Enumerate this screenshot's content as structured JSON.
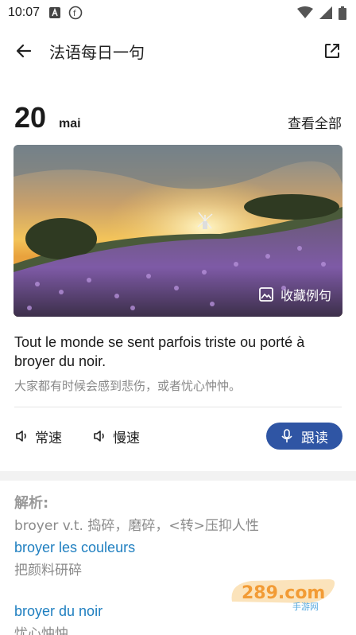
{
  "status_bar": {
    "time": "10:07",
    "left_icons": [
      "a-icon",
      "f-icon"
    ],
    "right_icons": [
      "wifi-icon",
      "signal-icon",
      "battery-icon"
    ]
  },
  "app_bar": {
    "title": "法语每日一句"
  },
  "date": {
    "day": "20",
    "month": "mai",
    "view_all": "查看全部"
  },
  "hero": {
    "favorite_label": "收藏例句"
  },
  "sentence": {
    "french": "Tout le monde se sent parfois triste ou porté à broyer du noir.",
    "chinese": "大家都有时候会感到悲伤，或者忧心忡忡。"
  },
  "controls": {
    "normal_speed": "常速",
    "slow_speed": "慢速",
    "follow_read": "跟读",
    "accent_color": "#2f55a4"
  },
  "analysis": {
    "title": "解析:",
    "definition": "broyer v.t. 捣碎，磨碎，<转>压抑人性",
    "example1_fr": "broyer les couleurs",
    "example1_zh": "把颜料研碎",
    "example2_fr": "broyer du noir",
    "example2_zh": "忧心忡忡",
    "link_color": "#1f7fc0"
  },
  "watermark": {
    "brand": "289.com",
    "sub": "手游网"
  }
}
